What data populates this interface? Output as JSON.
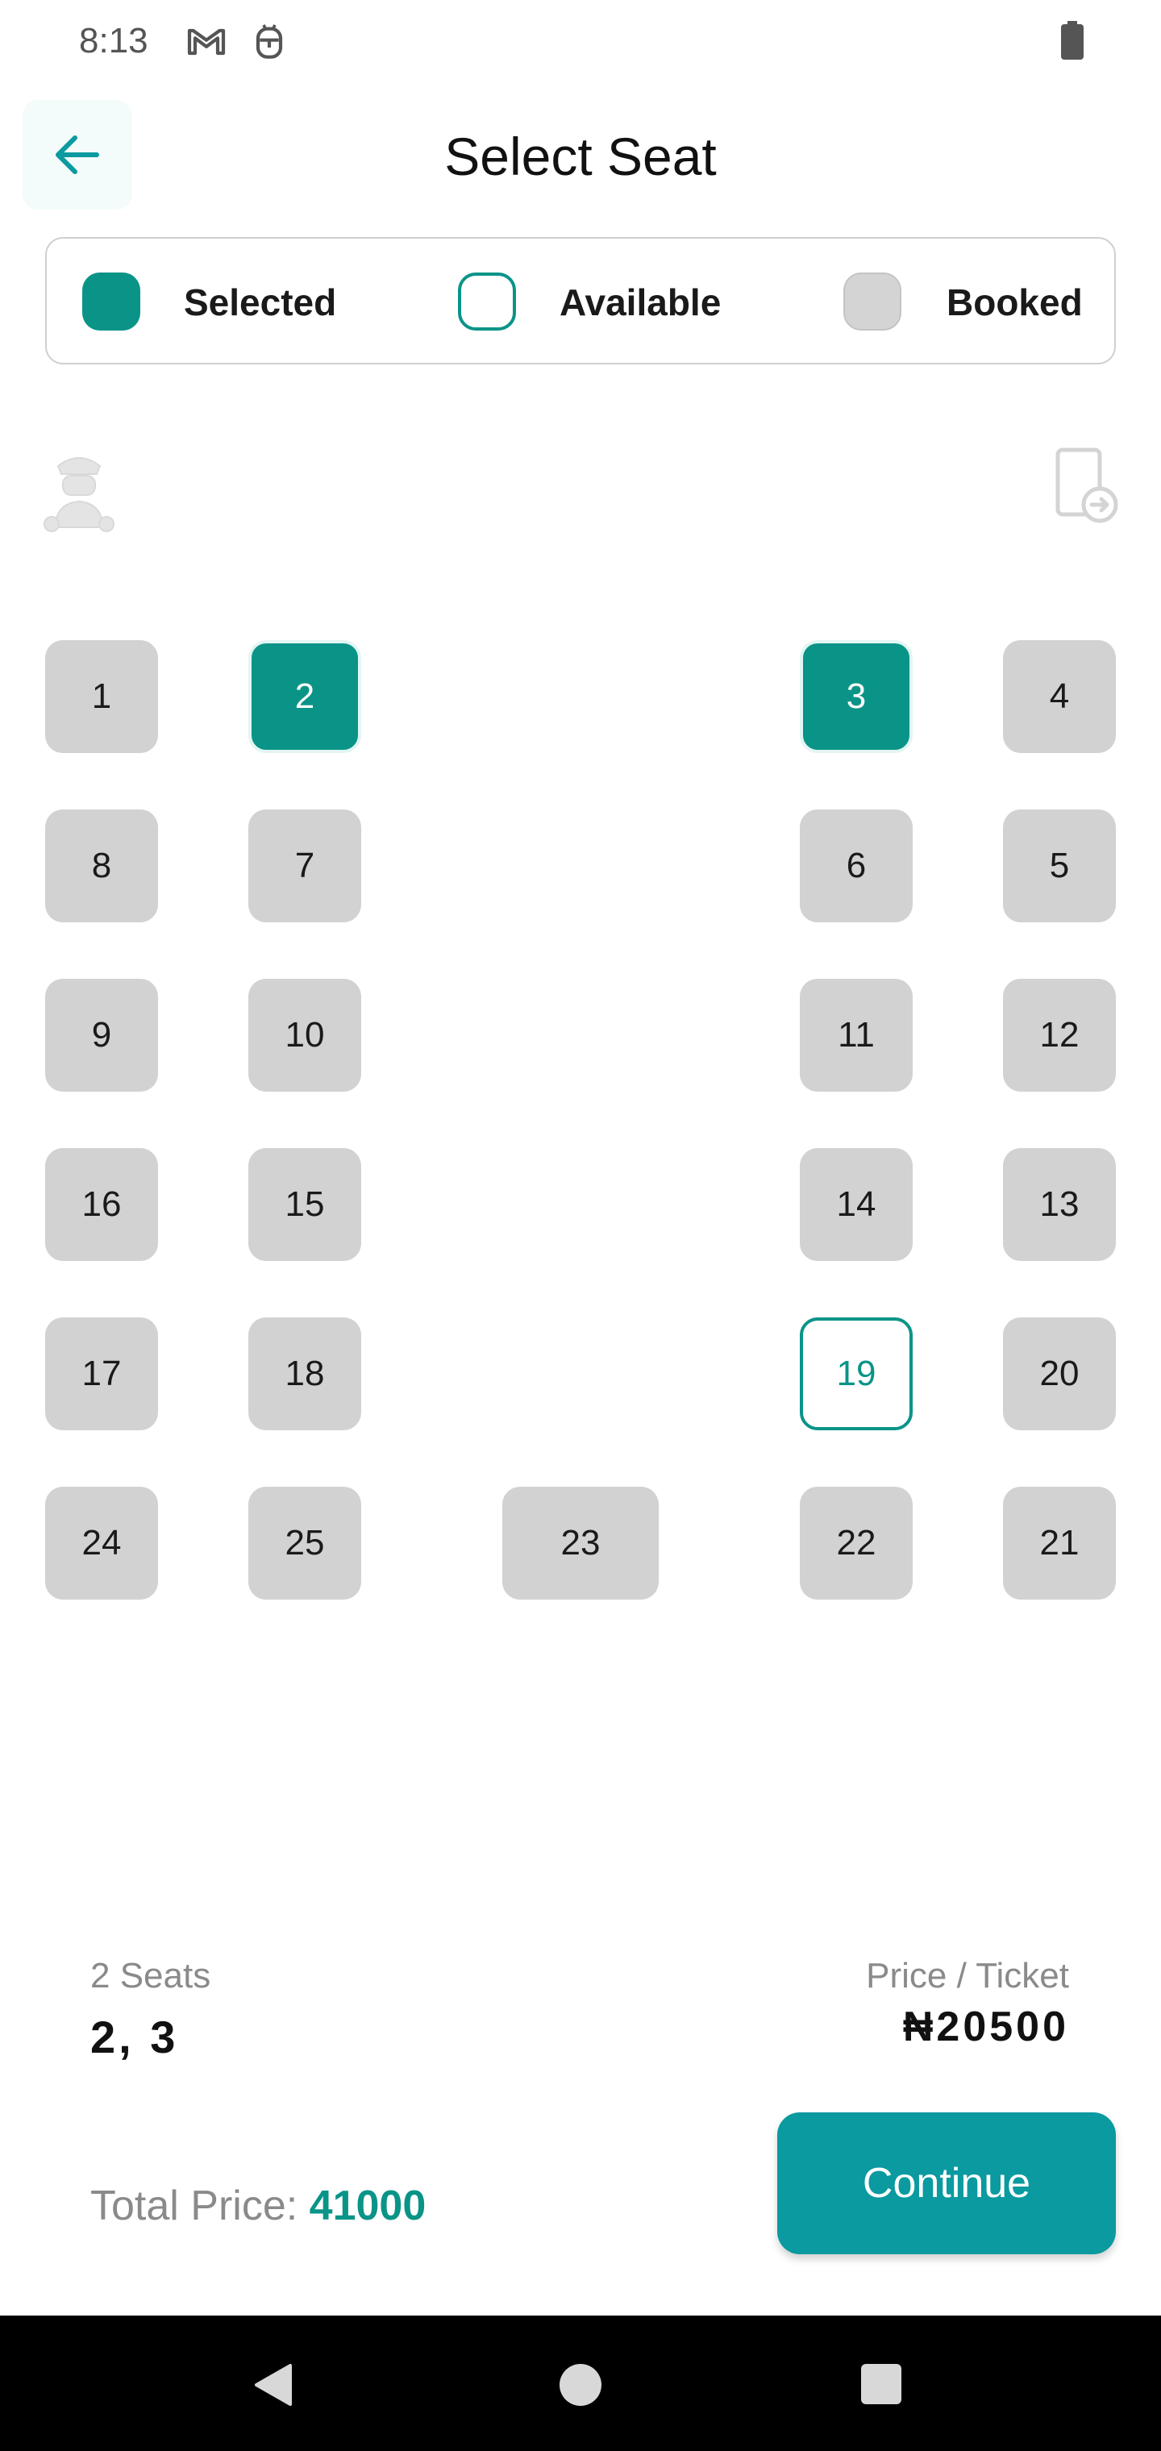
{
  "status_bar": {
    "time": "8:13",
    "icons": [
      "gmail-icon",
      "android-bot-icon",
      "battery-icon"
    ]
  },
  "header": {
    "title": "Select Seat",
    "back_icon": "arrow-left-icon"
  },
  "legend": {
    "selected": "Selected",
    "available": "Available",
    "booked": "Booked"
  },
  "colors": {
    "accent": "#0a9488",
    "button": "#0a9aa0",
    "booked": "#d2d2d2"
  },
  "seats": [
    {
      "number": "1",
      "status": "booked"
    },
    {
      "number": "2",
      "status": "selected"
    },
    {
      "number": "3",
      "status": "selected"
    },
    {
      "number": "4",
      "status": "booked"
    },
    {
      "number": "8",
      "status": "booked"
    },
    {
      "number": "7",
      "status": "booked"
    },
    {
      "number": "6",
      "status": "booked"
    },
    {
      "number": "5",
      "status": "booked"
    },
    {
      "number": "9",
      "status": "booked"
    },
    {
      "number": "10",
      "status": "booked"
    },
    {
      "number": "11",
      "status": "booked"
    },
    {
      "number": "12",
      "status": "booked"
    },
    {
      "number": "16",
      "status": "booked"
    },
    {
      "number": "15",
      "status": "booked"
    },
    {
      "number": "14",
      "status": "booked"
    },
    {
      "number": "13",
      "status": "booked"
    },
    {
      "number": "17",
      "status": "booked"
    },
    {
      "number": "18",
      "status": "booked"
    },
    {
      "number": "19",
      "status": "available"
    },
    {
      "number": "20",
      "status": "booked"
    },
    {
      "number": "24",
      "status": "booked"
    },
    {
      "number": "25",
      "status": "booked"
    },
    {
      "number": "23",
      "status": "booked"
    },
    {
      "number": "22",
      "status": "booked"
    },
    {
      "number": "21",
      "status": "booked"
    }
  ],
  "summary": {
    "seats_count": "2 Seats",
    "seats_list": "2, 3",
    "price_label": "Price / Ticket",
    "price_value": "₦20500",
    "total_label": "Total Price: ",
    "total_value": "41000"
  },
  "actions": {
    "continue_label": "Continue"
  }
}
